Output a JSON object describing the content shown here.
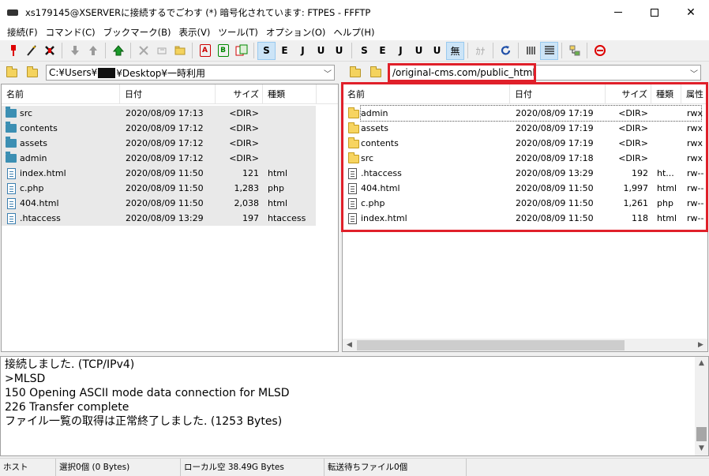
{
  "window": {
    "title": "xs179145@XSERVERに接続するでごわす (*) 暗号化されています: FTPES - FFFTP",
    "controls": [
      "minimize",
      "maximize",
      "close"
    ]
  },
  "menu": [
    "接続(F)",
    "コマンド(C)",
    "ブックマーク(B)",
    "表示(V)",
    "ツール(T)",
    "オプション(O)",
    "ヘルプ(H)"
  ],
  "toolbar": {
    "buttons": [
      {
        "name": "connect-icon"
      },
      {
        "name": "quick-connect-icon"
      },
      {
        "name": "disconnect-icon"
      },
      {
        "name": "download-icon"
      },
      {
        "name": "upload-icon"
      },
      {
        "name": "mirror-upload-icon"
      },
      {
        "name": "delete-icon"
      },
      {
        "name": "rename-icon"
      },
      {
        "name": "mkdir-icon"
      },
      {
        "name": "mode-ascii-icon",
        "label": "A"
      },
      {
        "name": "mode-binary-icon",
        "label": "B"
      },
      {
        "name": "mode-auto-icon"
      },
      {
        "name": "kanji-sjis-icon",
        "label": "S"
      },
      {
        "name": "kanji-euc-icon",
        "label": "E"
      },
      {
        "name": "kanji-jis-icon",
        "label": "J"
      },
      {
        "name": "kanji-utf8n-icon",
        "label": "U"
      },
      {
        "name": "kanji-utf8bom-icon",
        "label": "U"
      },
      {
        "name": "kanji-sjis-remote-icon",
        "label": "S"
      },
      {
        "name": "kanji-euc-remote-icon",
        "label": "E"
      },
      {
        "name": "kanji-jis-remote-icon",
        "label": "J"
      },
      {
        "name": "kanji-utf8n-remote-icon",
        "label": "U"
      },
      {
        "name": "kanji-utf8bom-remote-icon",
        "label": "U"
      },
      {
        "name": "kanji-none-icon",
        "label": "無"
      },
      {
        "name": "kana-convert-icon",
        "label": "ｶﾅ"
      },
      {
        "name": "refresh-icon"
      },
      {
        "name": "list-view-icon"
      },
      {
        "name": "detail-view-icon"
      },
      {
        "name": "sync-folder-icon"
      },
      {
        "name": "stop-icon"
      }
    ]
  },
  "local": {
    "path_prefix": "C:¥Users¥",
    "path_suffix": "¥Desktop¥一時利用",
    "columns": [
      "名前",
      "日付",
      "サイズ",
      "種類"
    ],
    "files": [
      {
        "name": "src",
        "date": "2020/08/09 17:13",
        "size": "<DIR>",
        "type": "",
        "dir": true
      },
      {
        "name": "contents",
        "date": "2020/08/09 17:12",
        "size": "<DIR>",
        "type": "",
        "dir": true
      },
      {
        "name": "assets",
        "date": "2020/08/09 17:12",
        "size": "<DIR>",
        "type": "",
        "dir": true
      },
      {
        "name": "admin",
        "date": "2020/08/09 17:12",
        "size": "<DIR>",
        "type": "",
        "dir": true
      },
      {
        "name": "index.html",
        "date": "2020/08/09 11:50",
        "size": "121",
        "type": "html",
        "dir": false
      },
      {
        "name": "c.php",
        "date": "2020/08/09 11:50",
        "size": "1,283",
        "type": "php",
        "dir": false
      },
      {
        "name": "404.html",
        "date": "2020/08/09 11:50",
        "size": "2,038",
        "type": "html",
        "dir": false
      },
      {
        "name": ".htaccess",
        "date": "2020/08/09 13:29",
        "size": "197",
        "type": "htaccess",
        "dir": false
      }
    ]
  },
  "remote": {
    "path": "/original-cms.com/public_html",
    "columns": [
      "名前",
      "日付",
      "サイズ",
      "種類",
      "属性"
    ],
    "files": [
      {
        "name": "admin",
        "date": "2020/08/09 17:19",
        "size": "<DIR>",
        "type": "",
        "attr": "rwx",
        "dir": true
      },
      {
        "name": "assets",
        "date": "2020/08/09 17:19",
        "size": "<DIR>",
        "type": "",
        "attr": "rwx",
        "dir": true
      },
      {
        "name": "contents",
        "date": "2020/08/09 17:19",
        "size": "<DIR>",
        "type": "",
        "attr": "rwx",
        "dir": true
      },
      {
        "name": "src",
        "date": "2020/08/09 17:18",
        "size": "<DIR>",
        "type": "",
        "attr": "rwx",
        "dir": true
      },
      {
        "name": ".htaccess",
        "date": "2020/08/09 13:29",
        "size": "192",
        "type": "ht...",
        "attr": "rw--",
        "dir": false
      },
      {
        "name": "404.html",
        "date": "2020/08/09 11:50",
        "size": "1,997",
        "type": "html",
        "attr": "rw--",
        "dir": false
      },
      {
        "name": "c.php",
        "date": "2020/08/09 11:50",
        "size": "1,261",
        "type": "php",
        "attr": "rw--",
        "dir": false
      },
      {
        "name": "index.html",
        "date": "2020/08/09 11:50",
        "size": "118",
        "type": "html",
        "attr": "rw--",
        "dir": false
      }
    ]
  },
  "log": [
    "接続しました. (TCP/IPv4)",
    ">MLSD",
    "150 Opening ASCII mode data connection for MLSD",
    "226 Transfer complete",
    "ファイル一覧の取得は正常終了しました. (1253 Bytes)"
  ],
  "status": {
    "host": "ホスト",
    "selection": "選択0個 (0 Bytes)",
    "local_free": "ローカル空 38.49G Bytes",
    "queue": "転送待ちファイル0個"
  },
  "colors": {
    "highlight": "#e0202a",
    "local_folder": "#3c8fb3",
    "remote_folder": "#f7d460"
  }
}
